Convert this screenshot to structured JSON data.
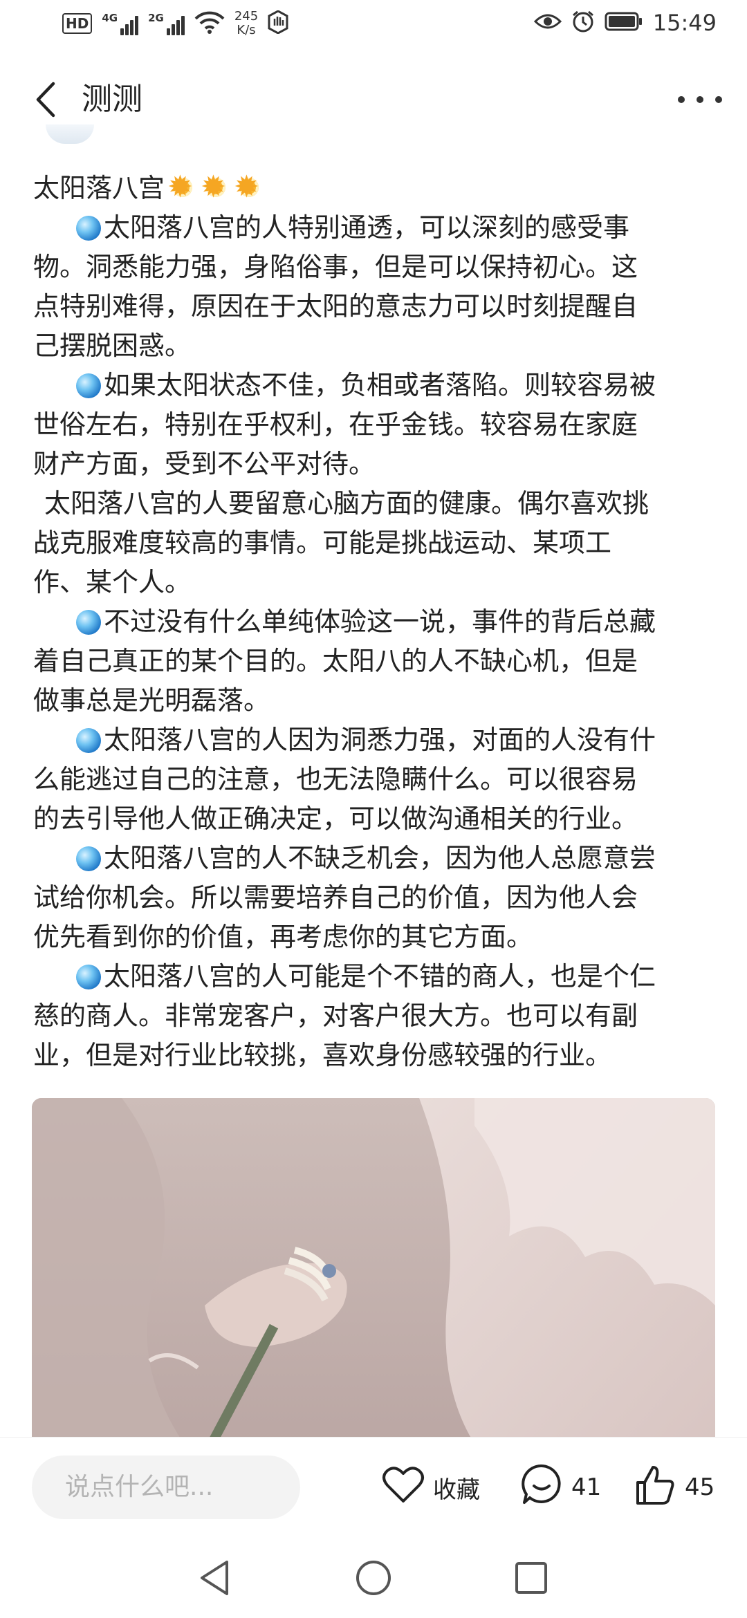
{
  "status_bar": {
    "network_badge": "HD",
    "net1": "4G",
    "net2": "2G",
    "speed_value": "245",
    "speed_unit": "K/s",
    "time": "15:49",
    "icons": [
      "hd-icon",
      "signal-icon",
      "signal-icon",
      "wifi-icon",
      "hand-icon",
      "eye-icon",
      "alarm-icon",
      "battery-icon"
    ]
  },
  "header": {
    "title": "测测",
    "back_icon": "chevron-left-icon",
    "more_icon": "more-dots-icon"
  },
  "article": {
    "title": "太阳落八宫",
    "title_emoji": [
      "sun-emoji",
      "sun-emoji",
      "sun-emoji"
    ],
    "bullet_icon": "crystal-ball-emoji",
    "paragraphs": [
      {
        "bullet": true,
        "lines": [
          "太阳落八宫的人特别通透，可以深刻的感受事",
          "物。洞悉能力强，身陷俗事，但是可以保持初心。这",
          "点特别难得，原因在于太阳的意志力可以时刻提醒自",
          "己摆脱困惑。"
        ]
      },
      {
        "bullet": true,
        "lines": [
          "如果太阳状态不佳，负相或者落陷。则较容易被",
          "世俗左右，特别在乎权利，在乎金钱。较容易在家庭",
          "财产方面，受到不公平对待。"
        ]
      },
      {
        "bullet": false,
        "lines": [
          "太阳落八宫的人要留意心脑方面的健康。偶尔喜欢挑",
          "战克服难度较高的事情。可能是挑战运动、某项工",
          "作、某个人。"
        ]
      },
      {
        "bullet": true,
        "lines": [
          "不过没有什么单纯体验这一说，事件的背后总藏",
          "着自己真正的某个目的。太阳八的人不缺心机，但是",
          "做事总是光明磊落。"
        ]
      },
      {
        "bullet": true,
        "lines": [
          "太阳落八宫的人因为洞悉力强，对面的人没有什",
          "么能逃过自己的注意，也无法隐瞒什么。可以很容易",
          "的去引导他人做正确决定，可以做沟通相关的行业。"
        ]
      },
      {
        "bullet": true,
        "lines": [
          "太阳落八宫的人不缺乏机会，因为他人总愿意尝",
          "试给你机会。所以需要培养自己的价值，因为他人会",
          "优先看到你的价值，再考虑你的其它方面。"
        ]
      },
      {
        "bullet": true,
        "lines": [
          "太阳落八宫的人可能是个不错的商人，也是个仁",
          "慈的商人。非常宠客户，对客户很大方。也可以有副",
          "业，但是对行业比较挑，喜欢身份感较强的行业。"
        ]
      }
    ]
  },
  "action_bar": {
    "comment_placeholder": "说点什么吧...",
    "favorite_label": "收藏",
    "comment_count": "41",
    "like_count": "45"
  },
  "colors": {
    "text": "#222222",
    "placeholder": "#b4b4b4",
    "input_bg": "#f3f3f3"
  }
}
